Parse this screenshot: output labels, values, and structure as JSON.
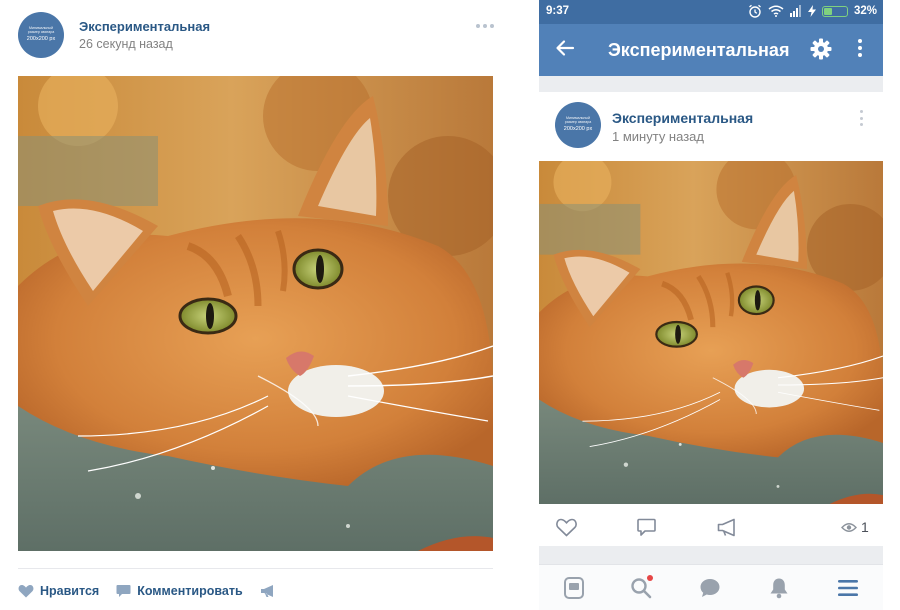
{
  "desktop_post": {
    "author": "Экспериментальная",
    "time": "26 секунд назад",
    "avatar": {
      "caption": "Минимальный размер аватара",
      "size": "200x200 px"
    },
    "actions": {
      "like_label": "Нравится",
      "comment_label": "Комментировать"
    }
  },
  "mobile": {
    "status_bar": {
      "time": "9:37",
      "battery_percent": "32%",
      "battery_level": 0.32
    },
    "header": {
      "title": "Экспериментальная"
    },
    "post": {
      "author": "Экспериментальная",
      "time": "1 минуту назад",
      "avatar": {
        "caption": "Минимальный размер аватара",
        "size": "200x200 px"
      },
      "views": "1"
    },
    "tab_bar": [
      "news-icon",
      "search-icon",
      "messages-icon",
      "notifications-icon",
      "menu-icon"
    ],
    "search_badge": true
  },
  "colors": {
    "link": "#2a5885",
    "brand_blue": "#5181b8",
    "status_bar": "#3f6da2",
    "muted_text": "#828282",
    "background_gray": "#ebedf0",
    "cat_orange": "#d8863a"
  },
  "icons": [
    "heart-icon",
    "comment-icon",
    "share-icon",
    "back-arrow-icon",
    "gear-icon",
    "more-icon",
    "eye-icon",
    "alarm-icon",
    "wifi-icon",
    "signal-icon",
    "battery-icon"
  ]
}
